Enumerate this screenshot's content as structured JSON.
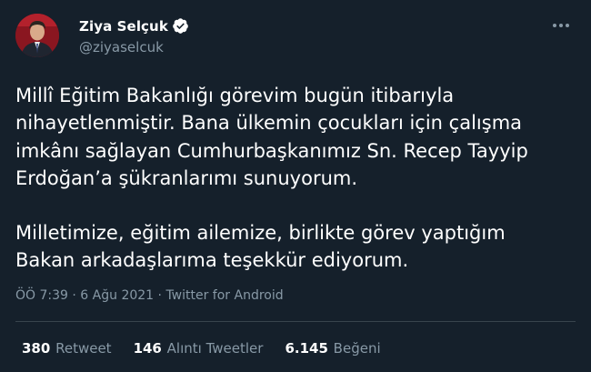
{
  "tweet": {
    "author": {
      "name": "Ziya Selçuk",
      "handle": "@ziyaselcuk",
      "verified_icon": "verified-badge-icon"
    },
    "paragraphs": [
      "Millî Eğitim Bakanlığı görevim bugün itibarıyla nihayetlenmiştir. Bana ülkemin çocukları için çalışma imkânı sağlayan Cumhurbaşkanımız Sn. Recep Tayyip Erdoğan’a şükranlarımı sunuyorum.",
      "Milletimize, eğitim ailemize, birlikte görev yaptığım Bakan arkadaşlarıma teşekkür ediyorum."
    ],
    "time": "ÖÖ 7:39",
    "date": "6 Ağu 2021",
    "separator": " · ",
    "source": "Twitter for Android",
    "stats": {
      "retweets": {
        "count": "380",
        "label": "Retweet"
      },
      "quotes": {
        "count": "146",
        "label": "Alıntı Tweetler"
      },
      "likes": {
        "count": "6.145",
        "label": "Beğeni"
      }
    }
  },
  "colors": {
    "background": "#15202b",
    "secondary_text": "#8899a6",
    "divider": "#38444d",
    "verified": "#ffffff"
  }
}
